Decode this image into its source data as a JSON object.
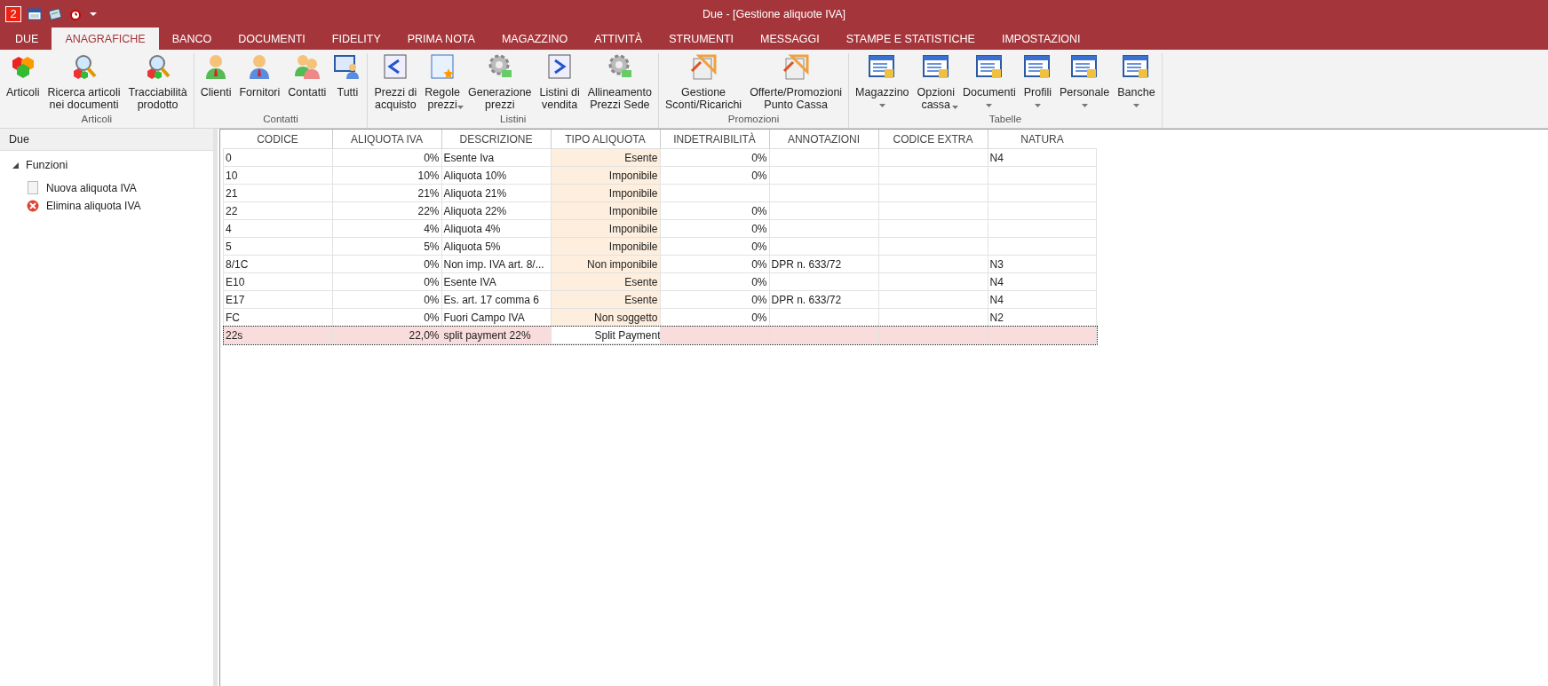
{
  "title_bar": {
    "app_badge": "2",
    "title": "Due - [Gestione aliquote IVA]"
  },
  "menu_tabs": [
    {
      "label": "DUE",
      "selected": false
    },
    {
      "label": "ANAGRAFICHE",
      "selected": true
    },
    {
      "label": "BANCO",
      "selected": false
    },
    {
      "label": "DOCUMENTI",
      "selected": false
    },
    {
      "label": "FIDELITY",
      "selected": false
    },
    {
      "label": "PRIMA NOTA",
      "selected": false
    },
    {
      "label": "MAGAZZINO",
      "selected": false
    },
    {
      "label": "ATTIVITÀ",
      "selected": false
    },
    {
      "label": "STRUMENTI",
      "selected": false
    },
    {
      "label": "MESSAGGI",
      "selected": false
    },
    {
      "label": "STAMPE E STATISTICHE",
      "selected": false
    },
    {
      "label": "IMPOSTAZIONI",
      "selected": false
    }
  ],
  "ribbon": [
    {
      "group": "Articoli",
      "items": [
        {
          "label_lines": [
            "Articoli"
          ]
        },
        {
          "label_lines": [
            "Ricerca articoli",
            "nei documenti"
          ]
        },
        {
          "label_lines": [
            "Tracciabilità",
            "prodotto"
          ]
        }
      ]
    },
    {
      "group": "Contatti",
      "items": [
        {
          "label_lines": [
            "Clienti"
          ]
        },
        {
          "label_lines": [
            "Fornitori"
          ]
        },
        {
          "label_lines": [
            "Contatti"
          ]
        },
        {
          "label_lines": [
            "Tutti"
          ]
        }
      ]
    },
    {
      "group": "Listini",
      "items": [
        {
          "label_lines": [
            "Prezzi di",
            "acquisto"
          ]
        },
        {
          "label_lines": [
            "Regole",
            "prezzi"
          ],
          "dropdown": true
        },
        {
          "label_lines": [
            "Generazione",
            "prezzi"
          ]
        },
        {
          "label_lines": [
            "Listini di",
            "vendita"
          ]
        },
        {
          "label_lines": [
            "Allineamento",
            "Prezzi Sede"
          ]
        }
      ]
    },
    {
      "group": "Promozioni",
      "items": [
        {
          "label_lines": [
            "Gestione",
            "Sconti/Ricarichi"
          ]
        },
        {
          "label_lines": [
            "Offerte/Promozioni",
            "Punto Cassa"
          ]
        }
      ]
    },
    {
      "group": "Tabelle",
      "items": [
        {
          "label_lines": [
            "Magazzino"
          ],
          "dropdown": true
        },
        {
          "label_lines": [
            "Opzioni",
            "cassa"
          ],
          "dropdown": true
        },
        {
          "label_lines": [
            "Documenti"
          ],
          "dropdown": true
        },
        {
          "label_lines": [
            "Profili"
          ],
          "dropdown": true
        },
        {
          "label_lines": [
            "Personale"
          ],
          "dropdown": true
        },
        {
          "label_lines": [
            "Banche"
          ],
          "dropdown": true
        }
      ]
    }
  ],
  "sidebar": {
    "header": "Due",
    "tree": [
      {
        "label": "Funzioni",
        "expanded": true,
        "children": [
          {
            "label": "Nuova aliquota IVA",
            "kind": "document"
          },
          {
            "label": "Elimina aliquota IVA",
            "kind": "delete"
          }
        ]
      }
    ]
  },
  "table": {
    "columns": [
      {
        "label": "CODICE",
        "selected": false
      },
      {
        "label": "ALIQUOTA IVA",
        "selected": false
      },
      {
        "label": "DESCRIZIONE",
        "selected": false
      },
      {
        "label": "TIPO ALIQUOTA",
        "selected": true
      },
      {
        "label": "INDETRAIBILITÀ",
        "selected": false
      },
      {
        "label": "ANNOTAZIONI",
        "selected": false
      },
      {
        "label": "CODICE EXTRA",
        "selected": false
      },
      {
        "label": "NATURA",
        "selected": false
      }
    ],
    "rows": [
      {
        "selected": false,
        "cells": [
          "0",
          "0%",
          "Esente Iva",
          "Esente",
          "0%",
          "",
          "",
          "N4"
        ]
      },
      {
        "selected": false,
        "cells": [
          "10",
          "10%",
          "Aliquota 10%",
          "Imponibile",
          "0%",
          "",
          "",
          ""
        ]
      },
      {
        "selected": false,
        "cells": [
          "21",
          "21%",
          "Aliquota 21%",
          "Imponibile",
          "",
          "",
          "",
          ""
        ]
      },
      {
        "selected": false,
        "cells": [
          "22",
          "22%",
          "Aliquota 22%",
          "Imponibile",
          "0%",
          "",
          "",
          ""
        ]
      },
      {
        "selected": false,
        "cells": [
          "4",
          "4%",
          "Aliquota 4%",
          "Imponibile",
          "0%",
          "",
          "",
          ""
        ]
      },
      {
        "selected": false,
        "cells": [
          "5",
          "5%",
          "Aliquota 5%",
          "Imponibile",
          "0%",
          "",
          "",
          ""
        ]
      },
      {
        "selected": false,
        "cells": [
          "8/1C",
          "0%",
          "Non imp. IVA art. 8/...",
          "Non imponibile",
          "0%",
          "DPR n. 633/72",
          "",
          "N3"
        ]
      },
      {
        "selected": false,
        "cells": [
          "E10",
          "0%",
          "Esente IVA",
          "Esente",
          "0%",
          "",
          "",
          "N4"
        ]
      },
      {
        "selected": false,
        "cells": [
          "E17",
          "0%",
          "Es. art. 17 comma 6",
          "Esente",
          "0%",
          "DPR n. 633/72",
          "",
          "N4"
        ]
      },
      {
        "selected": false,
        "cells": [
          "FC",
          "0%",
          "Fuori Campo IVA",
          "Non soggetto",
          "0%",
          "",
          "",
          "N2"
        ]
      },
      {
        "selected": true,
        "cells": [
          "22s",
          "22,0%",
          "split payment 22%",
          "Split Payment",
          "",
          "",
          "",
          ""
        ]
      }
    ]
  }
}
